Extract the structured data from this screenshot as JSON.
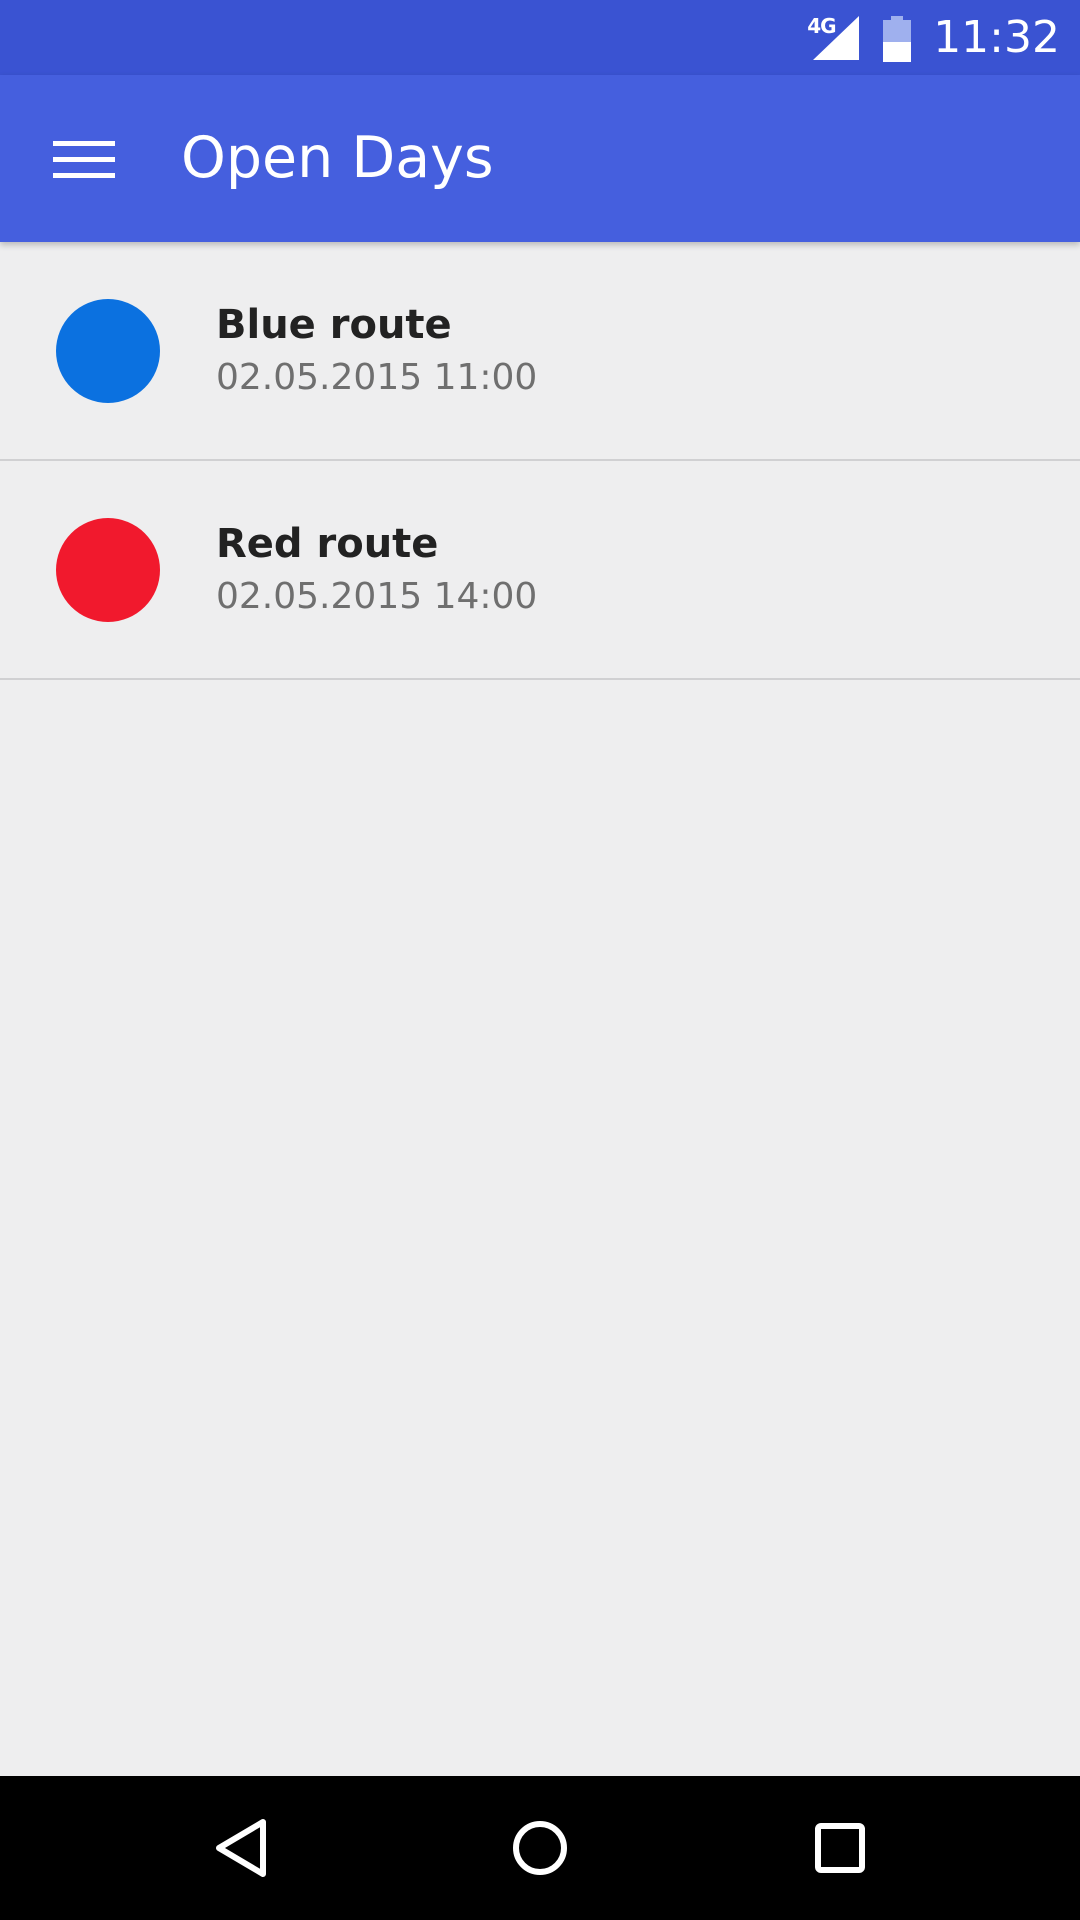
{
  "status_bar": {
    "network_type": "4G",
    "clock": "11:32",
    "icons": [
      "signal-icon",
      "battery-icon"
    ]
  },
  "app_bar": {
    "title": "Open Days",
    "menu_icon": "hamburger-menu-icon"
  },
  "routes": [
    {
      "name": "Blue route",
      "datetime": "02.05.2015 11:00",
      "color": "#0b71e0"
    },
    {
      "name": "Red route",
      "datetime": "02.05.2015 14:00",
      "color": "#f1192d"
    }
  ],
  "nav_bar": {
    "icons": [
      "back-icon",
      "home-icon",
      "recents-icon"
    ]
  },
  "colors": {
    "status_bar": "#3a53d2",
    "app_bar": "#455fde",
    "background": "#eeeeef"
  }
}
